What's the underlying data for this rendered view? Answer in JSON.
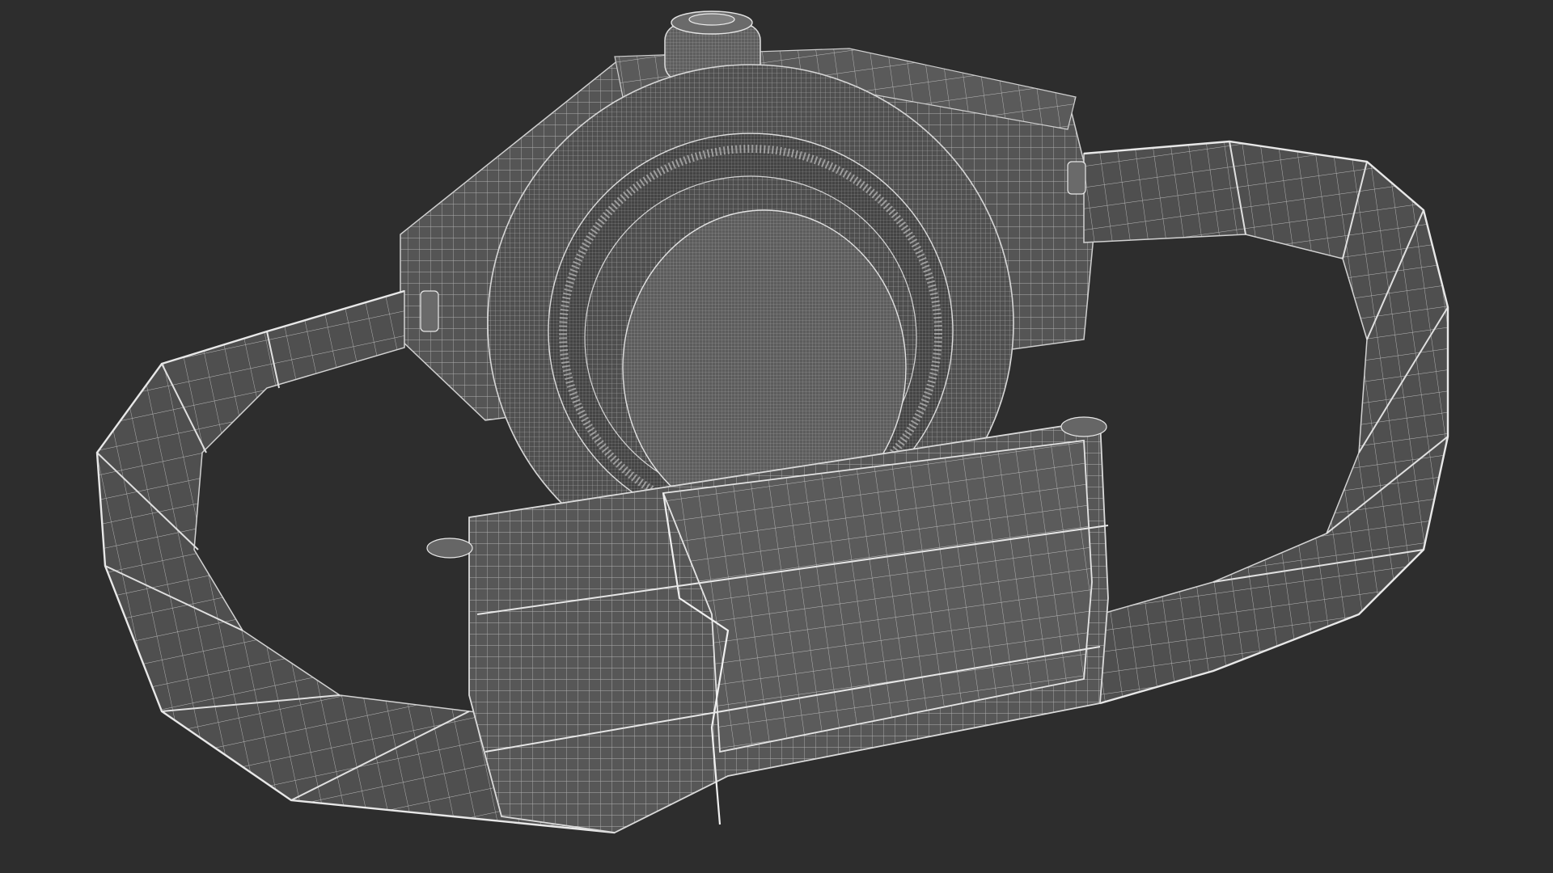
{
  "scene": {
    "background_color": "#2d2d2d",
    "mesh_fill_color": "#555555",
    "mesh_shade_color": "#4a4a4a",
    "mesh_wire_color": "#d9d9d9",
    "subject": "wristwatch-wireframe-render"
  }
}
